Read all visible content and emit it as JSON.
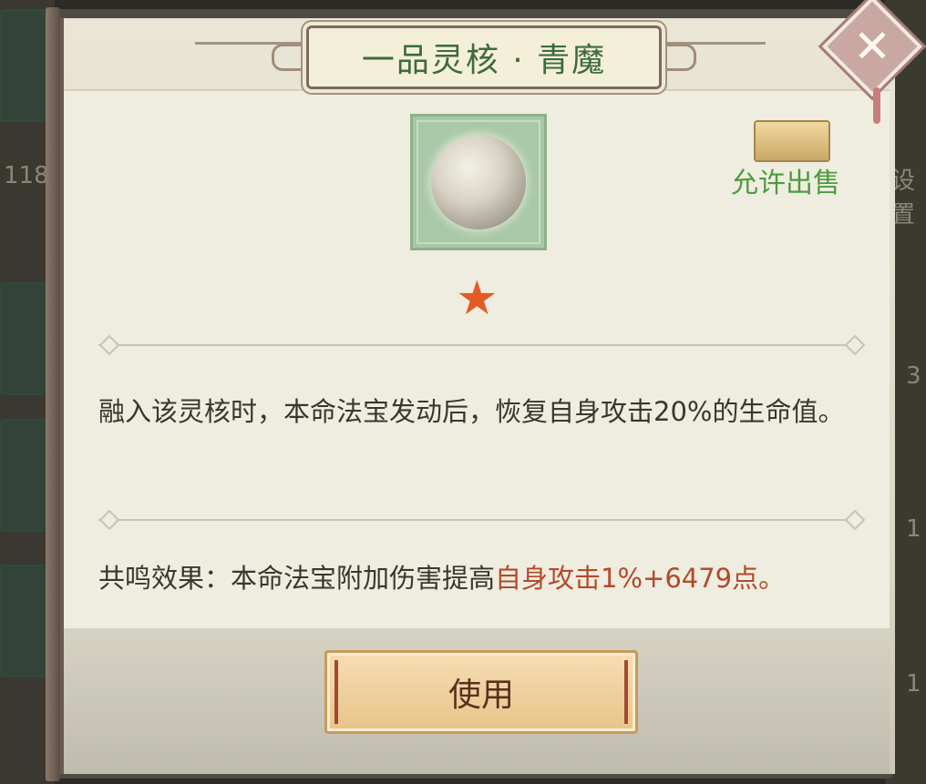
{
  "dialog": {
    "title": "一品灵核 · 青魔",
    "close_icon": "close-icon",
    "sell_status": "允许出售",
    "star_count": 1,
    "description": "融入该灵核时，本命法宝发动后，恢复自身攻击20%的生命值。",
    "resonance_label": "共鸣效果：本命法宝附加伤害提高",
    "resonance_value": "自身攻击1%+6479点。",
    "use_button": "使用"
  },
  "background": {
    "left_number": "118",
    "right_text": "设置",
    "right_numbers": [
      "3",
      "1",
      "1"
    ]
  },
  "colors": {
    "title_green": "#3d6b3c",
    "sell_green": "#4e9a3e",
    "highlight_red": "#b24a2c",
    "star_orange": "#e25a24"
  }
}
